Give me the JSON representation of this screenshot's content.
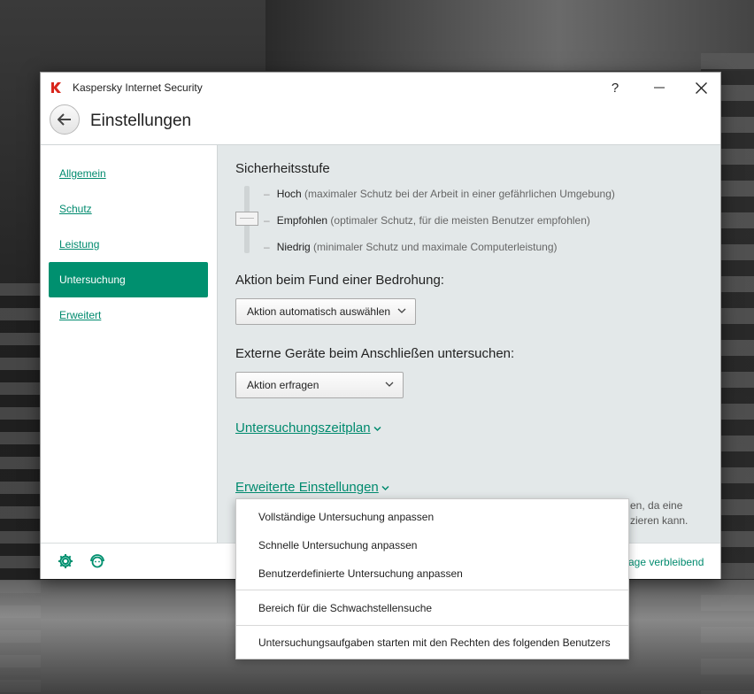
{
  "window": {
    "app_title": "Kaspersky Internet Security",
    "help_label": "?",
    "page_title": "Einstellungen"
  },
  "sidebar": {
    "items": [
      {
        "label": "Allgemein",
        "active": false
      },
      {
        "label": "Schutz",
        "active": false
      },
      {
        "label": "Leistung",
        "active": false
      },
      {
        "label": "Untersuchung",
        "active": true
      },
      {
        "label": "Erweitert",
        "active": false
      }
    ]
  },
  "main": {
    "security_level": {
      "title": "Sicherheitsstufe",
      "selected": "Empfohlen",
      "levels": [
        {
          "name": "Hoch",
          "desc": "(maximaler Schutz bei der Arbeit in einer gefährlichen Umgebung)"
        },
        {
          "name": "Empfohlen",
          "desc": "(optimaler Schutz, für die meisten Benutzer empfohlen)"
        },
        {
          "name": "Niedrig",
          "desc": "(minimaler Schutz und maximale Computerleistung)"
        }
      ]
    },
    "threat_action": {
      "label": "Aktion beim Fund einer Bedrohung:",
      "value": "Aktion automatisch auswählen"
    },
    "external_devices": {
      "label": "Externe Geräte beim Anschließen untersuchen:",
      "value": "Aktion erfragen"
    },
    "schedule_link": "Untersuchungszeitplan",
    "advanced_link": "Erweiterte Einstellungen",
    "partial_text_line1": "en, da eine",
    "partial_text_line2": "zieren kann."
  },
  "footer": {
    "settings_icon": "gear-icon",
    "support_icon": "support-icon",
    "license_partial": "age verbleibend"
  },
  "dropdown": {
    "items": [
      "Vollständige Untersuchung anpassen",
      "Schnelle Untersuchung anpassen",
      "Benutzerdefinierte Untersuchung anpassen",
      "Bereich für die Schwachstellensuche",
      "Untersuchungsaufgaben starten mit den Rechten des folgenden Benutzers"
    ]
  },
  "colors": {
    "accent": "#00906f",
    "link": "#008a6e",
    "content_bg": "#e3e8e9",
    "logo_red": "#d9261c"
  }
}
